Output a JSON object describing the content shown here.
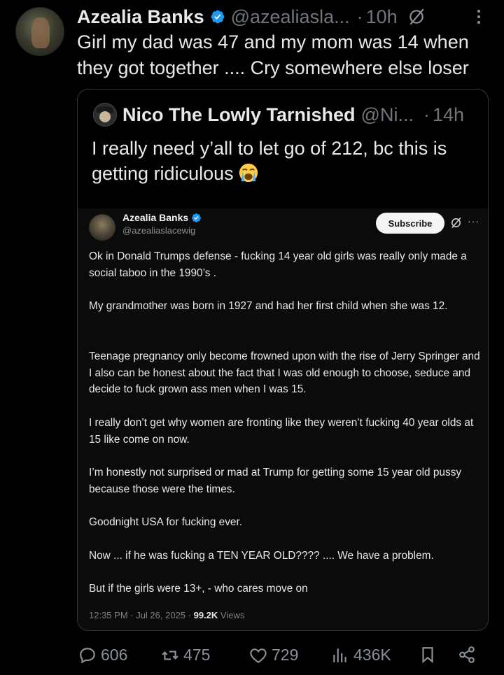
{
  "tweet": {
    "author_name": "Azealia Banks",
    "handle": "@azealiasla...",
    "separator": "·",
    "time": "10h",
    "text": "Girl my dad was 47 and my mom was 14 when they got together .... Cry somewhere else loser"
  },
  "quote": {
    "author_name": "Nico The Lowly Tarnished",
    "handle": "@Ni...",
    "separator": "·",
    "time": "14h",
    "text": "I really need y’all to let go of 212, bc this is getting ridiculous",
    "emoji_icon": "loudly-crying-face-icon"
  },
  "screenshot": {
    "author_name": "Azealia Banks",
    "handle": "@azealiaslacewig",
    "subscribe_label": "Subscribe",
    "more": "···",
    "paragraphs": [
      "Ok in Donald Trumps defense - fucking 14 year old girls was really only made a social taboo in the 1990’s .",
      "My grandmother was born in 1927 and had her first child when she was 12.",
      "Teenage pregnancy only become frowned upon with the rise of Jerry Springer and I also can be honest about the fact that I was old enough to choose, seduce and decide to fuck grown ass men when I was 15.",
      "I really don’t get why women are fronting like they weren’t fucking 40 year olds at 15 like come on now.",
      "I’m honestly not surprised or mad at Trump for getting some 15 year old pussy because those were the times.",
      "Goodnight USA for fucking ever.",
      "Now ... if he was fucking a TEN YEAR OLD???? .... We have a problem.",
      "But if the girls were 13+, - who cares move on"
    ],
    "timestamp": "12:35 PM · Jul 26, 2025 · ",
    "views_count": "99.2K",
    "views_label": " Views"
  },
  "actions": {
    "replies": "606",
    "reposts": "475",
    "likes": "729",
    "views": "436K"
  },
  "colors": {
    "background": "#000000",
    "text": "#e7e9ea",
    "muted": "#71767b",
    "verified": "#1d9bf0",
    "border": "#333639"
  }
}
